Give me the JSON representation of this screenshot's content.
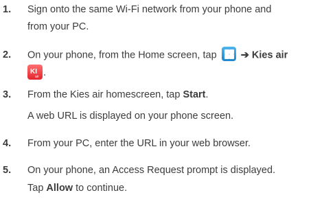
{
  "steps": [
    {
      "num": "1.",
      "line1": "Sign onto the same Wi-Fi network from your phone and",
      "line2": "from your PC."
    },
    {
      "num": "2.",
      "before": "On your phone, from the Home screen, tap",
      "arrow": "➔",
      "bold": "Kies air",
      "end": "."
    },
    {
      "num": "3.",
      "before": "From the Kies air homescreen, tap",
      "bold": "Start",
      "end": ".",
      "sub": "A web URL is displayed on your phone screen."
    },
    {
      "num": "4.",
      "line1": "From your PC, enter the URL in your web browser."
    },
    {
      "num": "5.",
      "line1": "On your phone, an Access Request prompt is displayed.",
      "line2_before": "Tap",
      "line2_bold": "Allow",
      "line2_after": "to continue."
    }
  ],
  "icons": {
    "apps": "apps-grid-icon",
    "kies": "kies-air-icon",
    "kies_text": "KI",
    "kies_sub": "air",
    "colors": {
      "apps": "#2a95dd",
      "kies": "#e8343a"
    }
  }
}
